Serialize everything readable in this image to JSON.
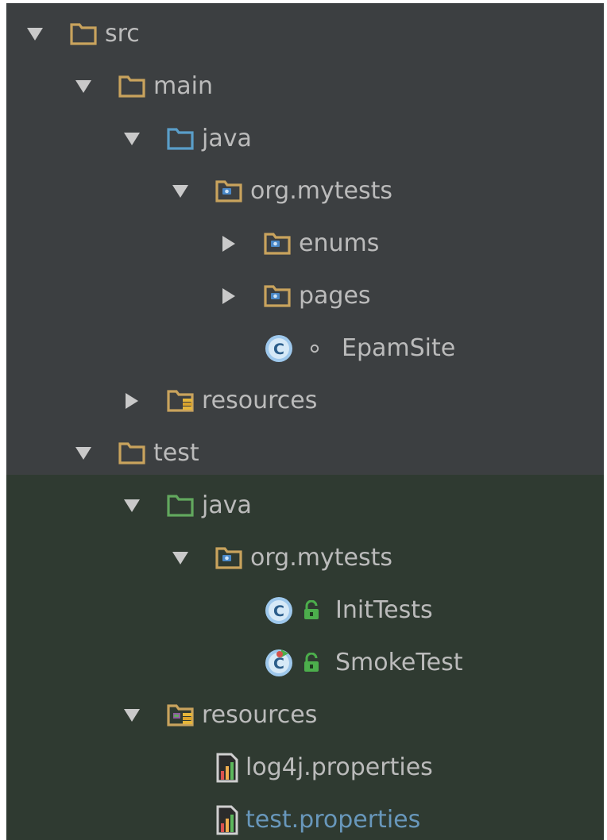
{
  "tree": {
    "nodes": [
      {
        "label": "src",
        "level": 0,
        "arrow": "expanded",
        "icon": "folder-icon",
        "color": "#c9a35d"
      },
      {
        "label": "main",
        "level": 1,
        "arrow": "expanded",
        "icon": "folder-icon",
        "color": "#c9a35d"
      },
      {
        "label": "java",
        "level": 2,
        "arrow": "expanded",
        "icon": "source-folder-icon",
        "color": "#5a9ec9"
      },
      {
        "label": "org.mytests",
        "level": 3,
        "arrow": "expanded",
        "icon": "package-icon",
        "color": "#c9a35d"
      },
      {
        "label": "enums",
        "level": 4,
        "arrow": "collapsed",
        "icon": "package-icon",
        "color": "#c9a35d"
      },
      {
        "label": "pages",
        "level": 4,
        "arrow": "collapsed",
        "icon": "package-icon",
        "color": "#c9a35d"
      },
      {
        "label": "EpamSite",
        "level": 4,
        "arrow": "none",
        "icon": "class-icon",
        "modifier": "package-private-icon"
      },
      {
        "label": "resources",
        "level": 2,
        "arrow": "collapsed",
        "icon": "resources-folder-icon",
        "color": "#c9a35d"
      },
      {
        "label": "test",
        "level": 1,
        "arrow": "expanded",
        "icon": "folder-icon",
        "color": "#c9a35d"
      },
      {
        "label": "java",
        "level": 2,
        "arrow": "expanded",
        "icon": "test-source-folder-icon",
        "color": "#62a85e"
      },
      {
        "label": "org.mytests",
        "level": 3,
        "arrow": "expanded",
        "icon": "package-icon",
        "color": "#c9a35d"
      },
      {
        "label": "InitTests",
        "level": 4,
        "arrow": "none",
        "icon": "class-icon",
        "modifier": "public-lock-icon"
      },
      {
        "label": "SmokeTest",
        "level": 4,
        "arrow": "none",
        "icon": "test-class-icon",
        "modifier": "public-lock-icon"
      },
      {
        "label": "resources",
        "level": 2,
        "arrow": "expanded",
        "icon": "test-resources-folder-icon",
        "color": "#c9a35d"
      },
      {
        "label": "log4j.properties",
        "level": 3,
        "arrow": "none",
        "icon": "properties-file-icon"
      },
      {
        "label": "test.properties",
        "level": 3,
        "arrow": "none",
        "icon": "properties-file-icon",
        "highlight": "#6897bb"
      }
    ]
  },
  "colors": {
    "main_background": "#3c3f41",
    "test_background": "#2f3a31",
    "text": "#bbbbbb",
    "folder": "#c9a35d",
    "source_folder": "#5a9ec9",
    "test_folder": "#62a85e"
  }
}
